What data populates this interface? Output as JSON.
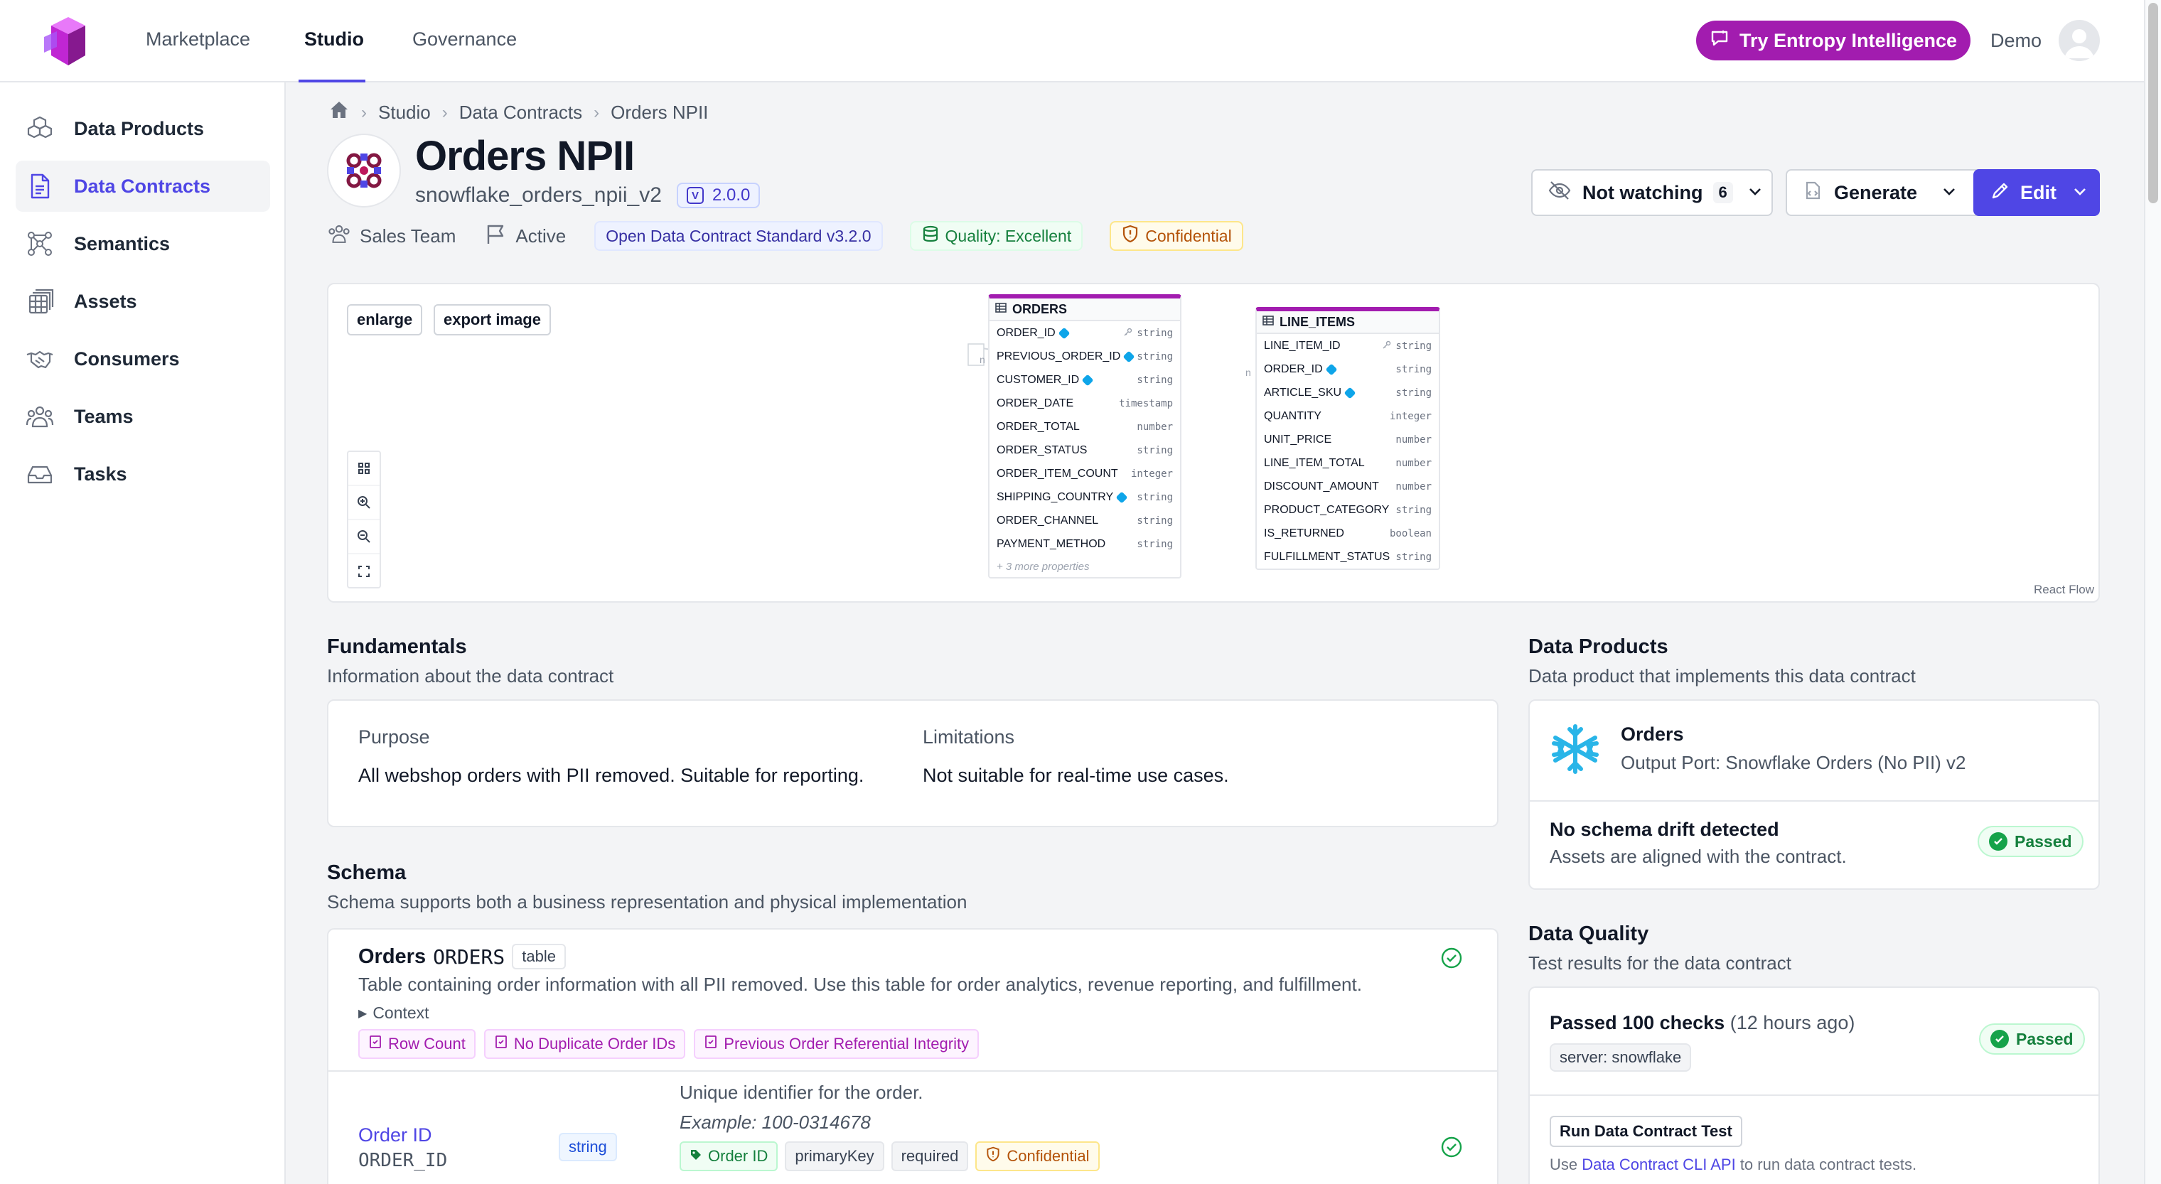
{
  "nav": {
    "links": [
      "Marketplace",
      "Studio",
      "Governance"
    ],
    "cta": "Try Entropy Intelligence",
    "user": "Demo"
  },
  "sidebar": {
    "items": [
      {
        "label": "Data Products",
        "icon": "cubes-icon"
      },
      {
        "label": "Data Contracts",
        "icon": "document-icon"
      },
      {
        "label": "Semantics",
        "icon": "graph-icon"
      },
      {
        "label": "Assets",
        "icon": "assets-icon"
      },
      {
        "label": "Consumers",
        "icon": "handshake-icon"
      },
      {
        "label": "Teams",
        "icon": "users-icon"
      },
      {
        "label": "Tasks",
        "icon": "inbox-icon"
      }
    ]
  },
  "breadcrumb": [
    "Studio",
    "Data Contracts",
    "Orders NPII"
  ],
  "contract": {
    "title": "Orders NPII",
    "id": "snowflake_orders_npii_v2",
    "version": "2.0.0",
    "version_letter": "V",
    "team": "Sales Team",
    "status": "Active",
    "standard": "Open Data Contract Standard v3.2.0",
    "quality": "Quality: Excellent",
    "classification": "Confidential"
  },
  "actions": {
    "watch": "Not watching",
    "watch_count": "6",
    "generate": "Generate",
    "edit": "Edit"
  },
  "diagram": {
    "enlarge": "enlarge",
    "export": "export image",
    "attribution": "React Flow",
    "orders": {
      "name": "ORDERS",
      "rows": [
        {
          "name": "ORDER_ID",
          "type": "string",
          "tag": true,
          "key": true
        },
        {
          "name": "PREVIOUS_ORDER_ID",
          "type": "string",
          "tag": true,
          "key": false
        },
        {
          "name": "CUSTOMER_ID",
          "type": "string",
          "tag": true,
          "key": false
        },
        {
          "name": "ORDER_DATE",
          "type": "timestamp",
          "tag": false,
          "key": false
        },
        {
          "name": "ORDER_TOTAL",
          "type": "number",
          "tag": false,
          "key": false
        },
        {
          "name": "ORDER_STATUS",
          "type": "string",
          "tag": false,
          "key": false
        },
        {
          "name": "ORDER_ITEM_COUNT",
          "type": "integer",
          "tag": false,
          "key": false
        },
        {
          "name": "SHIPPING_COUNTRY",
          "type": "string",
          "tag": true,
          "key": false
        },
        {
          "name": "ORDER_CHANNEL",
          "type": "string",
          "tag": false,
          "key": false
        },
        {
          "name": "PAYMENT_METHOD",
          "type": "string",
          "tag": false,
          "key": false
        }
      ],
      "more": "+ 3 more properties"
    },
    "line_items": {
      "name": "LINE_ITEMS",
      "rows": [
        {
          "name": "LINE_ITEM_ID",
          "type": "string",
          "tag": false,
          "key": true
        },
        {
          "name": "ORDER_ID",
          "type": "string",
          "tag": true,
          "key": false
        },
        {
          "name": "ARTICLE_SKU",
          "type": "string",
          "tag": true,
          "key": false
        },
        {
          "name": "QUANTITY",
          "type": "integer",
          "tag": false,
          "key": false
        },
        {
          "name": "UNIT_PRICE",
          "type": "number",
          "tag": false,
          "key": false
        },
        {
          "name": "LINE_ITEM_TOTAL",
          "type": "number",
          "tag": false,
          "key": false
        },
        {
          "name": "DISCOUNT_AMOUNT",
          "type": "number",
          "tag": false,
          "key": false
        },
        {
          "name": "PRODUCT_CATEGORY",
          "type": "string",
          "tag": false,
          "key": false
        },
        {
          "name": "IS_RETURNED",
          "type": "boolean",
          "tag": false,
          "key": false
        },
        {
          "name": "FULFILLMENT_STATUS",
          "type": "string",
          "tag": false,
          "key": false
        }
      ]
    },
    "edge_label_left": "n",
    "edge_label_right": "n"
  },
  "fundamentals": {
    "title": "Fundamentals",
    "subtitle": "Information about the data contract",
    "purpose_label": "Purpose",
    "purpose": "All webshop orders with PII removed. Suitable for reporting.",
    "limitations_label": "Limitations",
    "limitations": "Not suitable for real-time use cases."
  },
  "schema": {
    "title": "Schema",
    "subtitle": "Schema supports both a business representation and physical implementation",
    "table_name": "Orders",
    "table_physical": "ORDERS",
    "table_type": "table",
    "table_description": "Table containing order information with all PII removed. Use this table for order analytics, revenue reporting, and fulfillment.",
    "context": "Context",
    "checks": [
      "Row Count",
      "No Duplicate Order IDs",
      "Previous Order Referential Integrity"
    ],
    "field": {
      "name": "Order ID",
      "physical": "ORDER_ID",
      "type": "string",
      "description": "Unique identifier for the order.",
      "example": "Example: 100-0314678",
      "tags": [
        "Order ID",
        "primaryKey",
        "required",
        "Confidential"
      ]
    }
  },
  "data_products": {
    "title": "Data Products",
    "subtitle": "Data product that implements this data contract",
    "product_name": "Orders",
    "output_port": "Output Port: Snowflake Orders (No PII) v2",
    "drift_title": "No schema drift detected",
    "drift_sub": "Assets are aligned with the contract.",
    "drift_status": "Passed"
  },
  "data_quality": {
    "title": "Data Quality",
    "subtitle": "Test results for the data contract",
    "checks_passed": "Passed 100 checks",
    "checks_time": "(12 hours ago)",
    "status": "Passed",
    "server": "server: snowflake",
    "run_button": "Run Data Contract Test",
    "cli_prefix": "Use",
    "cli_link": "Data Contract CLI API",
    "cli_suffix": "to run data contract tests."
  },
  "colors": {
    "accent": "#4f46e5",
    "brand": "#a21caf",
    "success": "#16a34a",
    "warning": "#b45309",
    "snowflake": "#29b5e8"
  }
}
